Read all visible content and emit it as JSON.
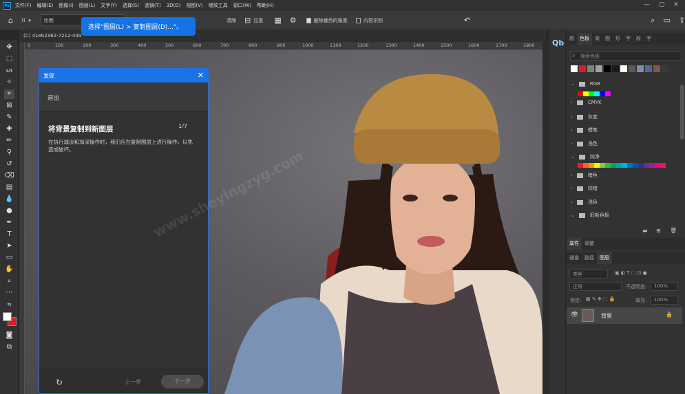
{
  "menubar": {
    "logo": "Ps",
    "items": [
      "文件(F)",
      "编辑(E)",
      "图像(I)",
      "图层(L)",
      "文字(Y)",
      "选择(S)",
      "滤镜(T)",
      "3D(D)",
      "视图(V)",
      "增效工具",
      "窗口(W)",
      "帮助(H)"
    ]
  },
  "options": {
    "ratio_select": "比例",
    "clear_label": "清除",
    "straighten_label": "拉直",
    "delete_cropped_label": "删除裁剪的像素",
    "content_aware_label": "内容识别"
  },
  "tooltip": "选择\"图层(L) > 复制图层(D)...\"。",
  "document": {
    "tab_title": "(C) 41eb2382-7212-4da"
  },
  "ruler": {
    "ticks": [
      "0",
      "100",
      "200",
      "300",
      "400",
      "500",
      "600",
      "700",
      "800",
      "900",
      "1000",
      "1100",
      "1200",
      "1300",
      "1400",
      "1500",
      "1600",
      "1700",
      "1800"
    ]
  },
  "guide": {
    "header": "发现",
    "exit": "退出",
    "title": "将背景复制到新图层",
    "step": "1/7",
    "description": "在执行减淡和加深操作时，我们应在复制图层上进行操作，以免造成破坏。",
    "prev": "上一步",
    "next": "下一步"
  },
  "watermark": "www.sheyingzyg.com",
  "swatches_panel": {
    "tabs": [
      "颜",
      "色板",
      "渐",
      "图",
      "形",
      "字",
      "段",
      "字"
    ],
    "search_placeholder": "搜索色板",
    "groups": [
      {
        "name": "RGB",
        "open": true
      },
      {
        "name": "CMYK",
        "open": false
      },
      {
        "name": "灰度",
        "open": false
      },
      {
        "name": "蜡笔",
        "open": false
      },
      {
        "name": "浅色",
        "open": false
      },
      {
        "name": "纯净",
        "open": true
      },
      {
        "name": "暗色",
        "open": false
      },
      {
        "name": "较暗",
        "open": false
      },
      {
        "name": "浅色",
        "open": false
      },
      {
        "name": "旧新色板",
        "open": true
      }
    ],
    "top_colors": [
      "#ffffff",
      "#e21b22",
      "#808080",
      "#a0a0a0",
      "#000000",
      "#1a1a1a",
      "#ffffff",
      "#5a5a5a",
      "#7a8fb0",
      "#546a8c",
      "#7b5a4a",
      "#3a3a3a"
    ],
    "rgb_colors": [
      "#ff0000",
      "#ffff00",
      "#00ff00",
      "#00ffff",
      "#0000ff",
      "#ff00ff"
    ],
    "pure_colors": [
      "#ed1c24",
      "#f26522",
      "#f7941d",
      "#fff200",
      "#8dc63f",
      "#39b54a",
      "#00a651",
      "#00a99d",
      "#00aeef",
      "#0072bc",
      "#0054a6",
      "#2e3192",
      "#662d91",
      "#92278f",
      "#ec008c",
      "#ed145b"
    ]
  },
  "layers_panel": {
    "top_tabs": [
      "属性",
      "调整"
    ],
    "tabs": [
      "通道",
      "路径",
      "图层"
    ],
    "kind_filter": "类型",
    "blend_mode": "正常",
    "opacity_label": "不透明度:",
    "opacity_value": "100%",
    "lock_label": "锁定:",
    "fill_label": "填充:",
    "fill_value": "100%",
    "layer_name": "背景"
  }
}
